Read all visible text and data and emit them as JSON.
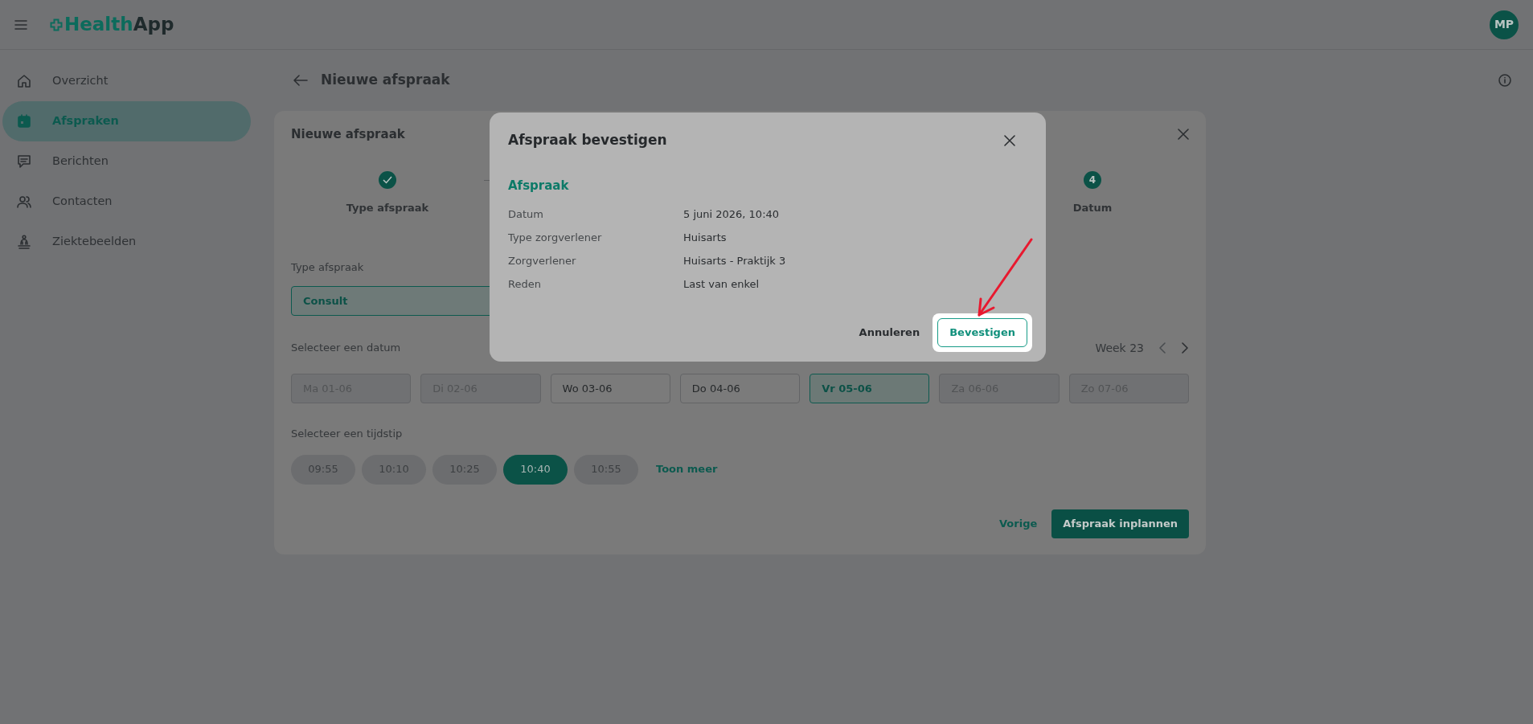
{
  "header": {
    "logo": {
      "part_1": "Health",
      "part_2": "App"
    },
    "avatar": "MP"
  },
  "sidebar": {
    "items": [
      {
        "label": "Overzicht",
        "selected": false
      },
      {
        "label": "Afspraken",
        "selected": true
      },
      {
        "label": "Berichten",
        "selected": false
      },
      {
        "label": "Contacten",
        "selected": false
      },
      {
        "label": "Ziektebeelden",
        "selected": false
      }
    ]
  },
  "page": {
    "title": "Nieuwe afspraak"
  },
  "card": {
    "title": "Nieuwe afspraak",
    "steps": [
      {
        "kind": "done",
        "label": "Type afspraak"
      },
      {
        "kind": "current",
        "number": "4",
        "label": "Datum"
      }
    ],
    "type_field": {
      "label": "Type afspraak",
      "value": "Consult"
    },
    "date": {
      "label": "Selecteer een datum",
      "week": "Week 23",
      "days": [
        {
          "label": "Ma 01-06",
          "disabled": true,
          "selected": false
        },
        {
          "label": "Di 02-06",
          "disabled": true,
          "selected": false
        },
        {
          "label": "Wo 03-06",
          "disabled": false,
          "selected": false
        },
        {
          "label": "Do 04-06",
          "disabled": false,
          "selected": false
        },
        {
          "label": "Vr 05-06",
          "disabled": false,
          "selected": true
        },
        {
          "label": "Za 06-06",
          "disabled": true,
          "selected": false
        },
        {
          "label": "Zo 07-06",
          "disabled": true,
          "selected": false
        }
      ]
    },
    "time": {
      "label": "Selecteer een tijdstip",
      "slots": [
        {
          "label": "09:55",
          "selected": false
        },
        {
          "label": "10:10",
          "selected": false
        },
        {
          "label": "10:25",
          "selected": false
        },
        {
          "label": "10:40",
          "selected": true
        },
        {
          "label": "10:55",
          "selected": false
        }
      ],
      "more": "Toon meer"
    },
    "actions": {
      "back": "Vorige",
      "submit": "Afspraak inplannen"
    }
  },
  "modal": {
    "title": "Afspraak bevestigen",
    "section": "Afspraak",
    "rows": [
      {
        "label": "Datum",
        "value": "5 juni 2026, 10:40"
      },
      {
        "label": "Type zorgverlener",
        "value": "Huisarts"
      },
      {
        "label": "Zorgverlener",
        "value": "Huisarts - Praktijk 3"
      },
      {
        "label": "Reden",
        "value": "Last van enkel"
      }
    ],
    "cancel": "Annuleren",
    "confirm": "Bevestigen"
  }
}
